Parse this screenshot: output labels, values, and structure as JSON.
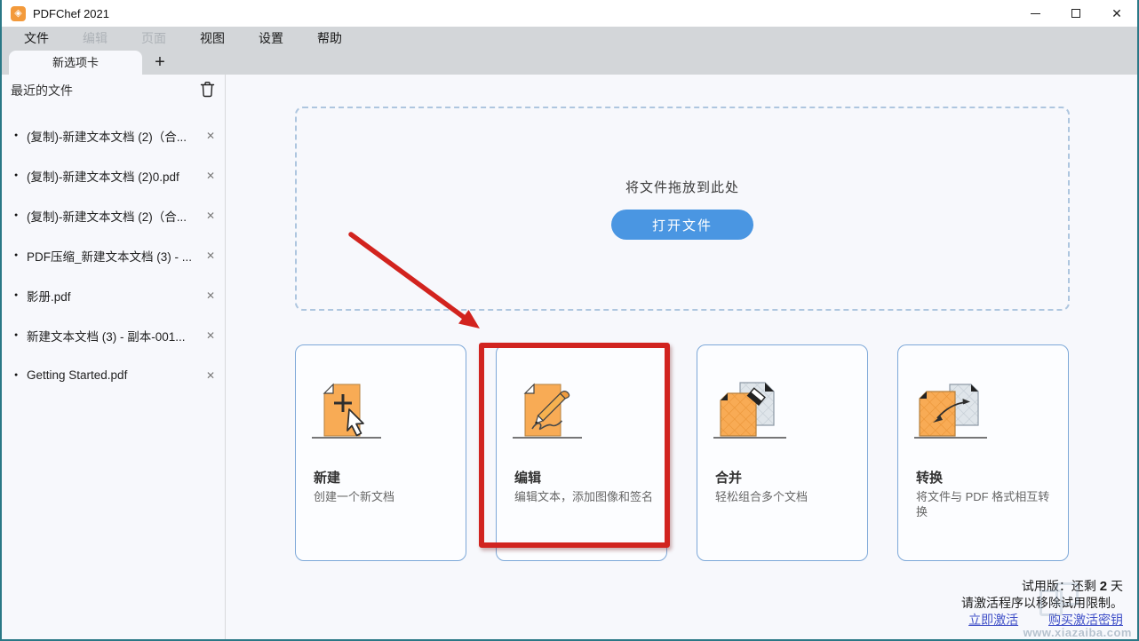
{
  "window": {
    "title": "PDFChef 2021"
  },
  "icons": {
    "app_logo": "◈",
    "minimize": "─",
    "maximize": "□",
    "close": "✕",
    "new_tab": "+",
    "bullet": "●",
    "list_close": "✕",
    "trash": "trash-icon"
  },
  "menu": {
    "items": [
      {
        "label": "文件",
        "enabled": true
      },
      {
        "label": "编辑",
        "enabled": false
      },
      {
        "label": "页面",
        "enabled": false
      },
      {
        "label": "视图",
        "enabled": true
      },
      {
        "label": "设置",
        "enabled": true
      },
      {
        "label": "帮助",
        "enabled": true
      }
    ]
  },
  "tabs": {
    "active_label": "新选项卡"
  },
  "sidebar": {
    "header": "最近的文件",
    "files": [
      "(复制)-新建文本文档 (2)（合...",
      "(复制)-新建文本文档 (2)0.pdf",
      "(复制)-新建文本文档 (2)（合...",
      "PDF压缩_新建文本文档 (3) - ...",
      "影册.pdf",
      "新建文本文档 (3) - 副本-001...",
      "Getting Started.pdf"
    ]
  },
  "dropzone": {
    "hint": "将文件拖放到此处",
    "open_button": "打开文件"
  },
  "cards": [
    {
      "title": "新建",
      "subtitle": "创建一个新文档",
      "icon": "new-document-icon",
      "highlighted": false
    },
    {
      "title": "编辑",
      "subtitle": "编辑文本，添加图像和签名",
      "icon": "edit-signature-icon",
      "highlighted": true
    },
    {
      "title": "合并",
      "subtitle": "轻松组合多个文档",
      "icon": "merge-documents-icon",
      "highlighted": false
    },
    {
      "title": "转换",
      "subtitle": "将文件与 PDF 格式相互转换",
      "icon": "convert-documents-icon",
      "highlighted": false
    }
  ],
  "trial": {
    "prefix": "试用版：还剩 ",
    "days": "2",
    "suffix": " 天",
    "line2": "请激活程序以移除试用限制。",
    "activate_link": "立即激活",
    "buy_link": "购买激活密钥"
  },
  "watermark": {
    "text": "www.xiazaiba.com"
  },
  "colors": {
    "accent_blue": "#4a96e2",
    "card_border": "#7da8d8",
    "highlight_red": "#d12420",
    "window_border": "#2a7886",
    "bar_gray": "#d3d6d9",
    "doc_orange": "#f8ab55"
  }
}
